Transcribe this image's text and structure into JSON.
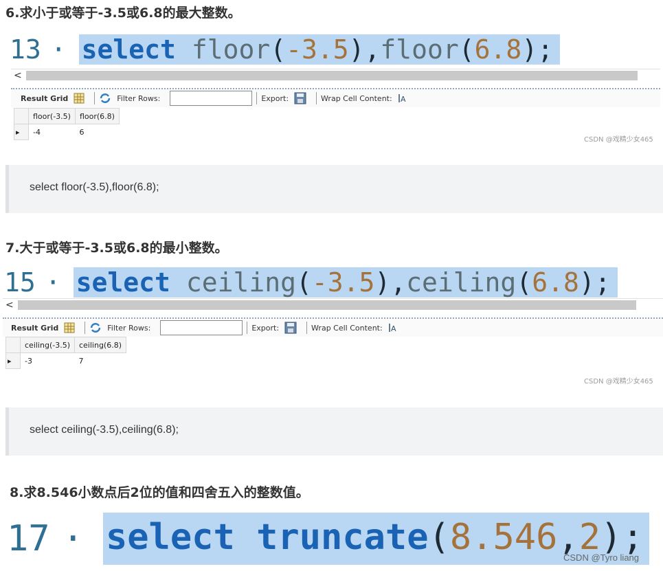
{
  "sections": [
    {
      "heading": "6.求小于或等于-3.5或6.8的最大整数。",
      "line_number": "13",
      "tokens": [
        {
          "t": "select",
          "c": "kw"
        },
        {
          "t": " ",
          "c": "punc"
        },
        {
          "t": "floor",
          "c": "fn"
        },
        {
          "t": "(",
          "c": "punc"
        },
        {
          "t": "-3.5",
          "c": "num"
        },
        {
          "t": "),",
          "c": "punc"
        },
        {
          "t": "floor",
          "c": "fn"
        },
        {
          "t": "(",
          "c": "punc"
        },
        {
          "t": "6.8",
          "c": "num"
        },
        {
          "t": ");",
          "c": "punc"
        }
      ],
      "columns": [
        "floor(-3.5)",
        "floor(6.8)"
      ],
      "rows": [
        [
          "-4",
          "6"
        ]
      ],
      "watermark": "CSDN @戏精少女465",
      "code_text": "select floor(-3.5),floor(6.8);"
    },
    {
      "heading": "7.大于或等于-3.5或6.8的最小整数。",
      "line_number": "15",
      "tokens": [
        {
          "t": "select",
          "c": "kw"
        },
        {
          "t": " ",
          "c": "punc"
        },
        {
          "t": "ceiling",
          "c": "fn"
        },
        {
          "t": "(",
          "c": "punc"
        },
        {
          "t": "-3.5",
          "c": "num"
        },
        {
          "t": "),",
          "c": "punc"
        },
        {
          "t": "ceiling",
          "c": "fn"
        },
        {
          "t": "(",
          "c": "punc"
        },
        {
          "t": "6.8",
          "c": "num"
        },
        {
          "t": ");",
          "c": "punc"
        }
      ],
      "columns": [
        "ceiling(-3.5)",
        "ceiling(6.8)"
      ],
      "rows": [
        [
          "-3",
          "7"
        ]
      ],
      "watermark": "CSDN @戏精少女465",
      "code_text": "select ceiling(-3.5),ceiling(6.8);"
    },
    {
      "heading": "8.求8.546小数点后2位的值和四舍五入的整数值。",
      "line_number": "17",
      "tokens": [
        {
          "t": "select",
          "c": "kw"
        },
        {
          "t": " ",
          "c": "kw"
        },
        {
          "t": "truncate",
          "c": "kw"
        },
        {
          "t": "(",
          "c": "punc"
        },
        {
          "t": "8.546",
          "c": "num"
        },
        {
          "t": ",",
          "c": "punc"
        },
        {
          "t": "2",
          "c": "num"
        },
        {
          "t": ");",
          "c": "punc"
        }
      ],
      "watermark": "CSDN @Tyro liang"
    }
  ],
  "toolbar": {
    "result_grid": "Result Grid",
    "filter_rows": "Filter Rows:",
    "export": "Export:",
    "wrap_cell": "Wrap Cell Content:",
    "icons": [
      "grid-view-icon",
      "refresh-icon",
      "export-save-icon",
      "wrap-text-icon"
    ]
  },
  "scroll_arrow": "<",
  "line_dot": "·",
  "colors": {
    "selection": "#b9d7f2",
    "keyword": "#1a62b3",
    "function": "#5b6d75",
    "number": "#a4723a",
    "line_number": "#2e6f92",
    "codebox_bg": "#f2f3f5"
  }
}
